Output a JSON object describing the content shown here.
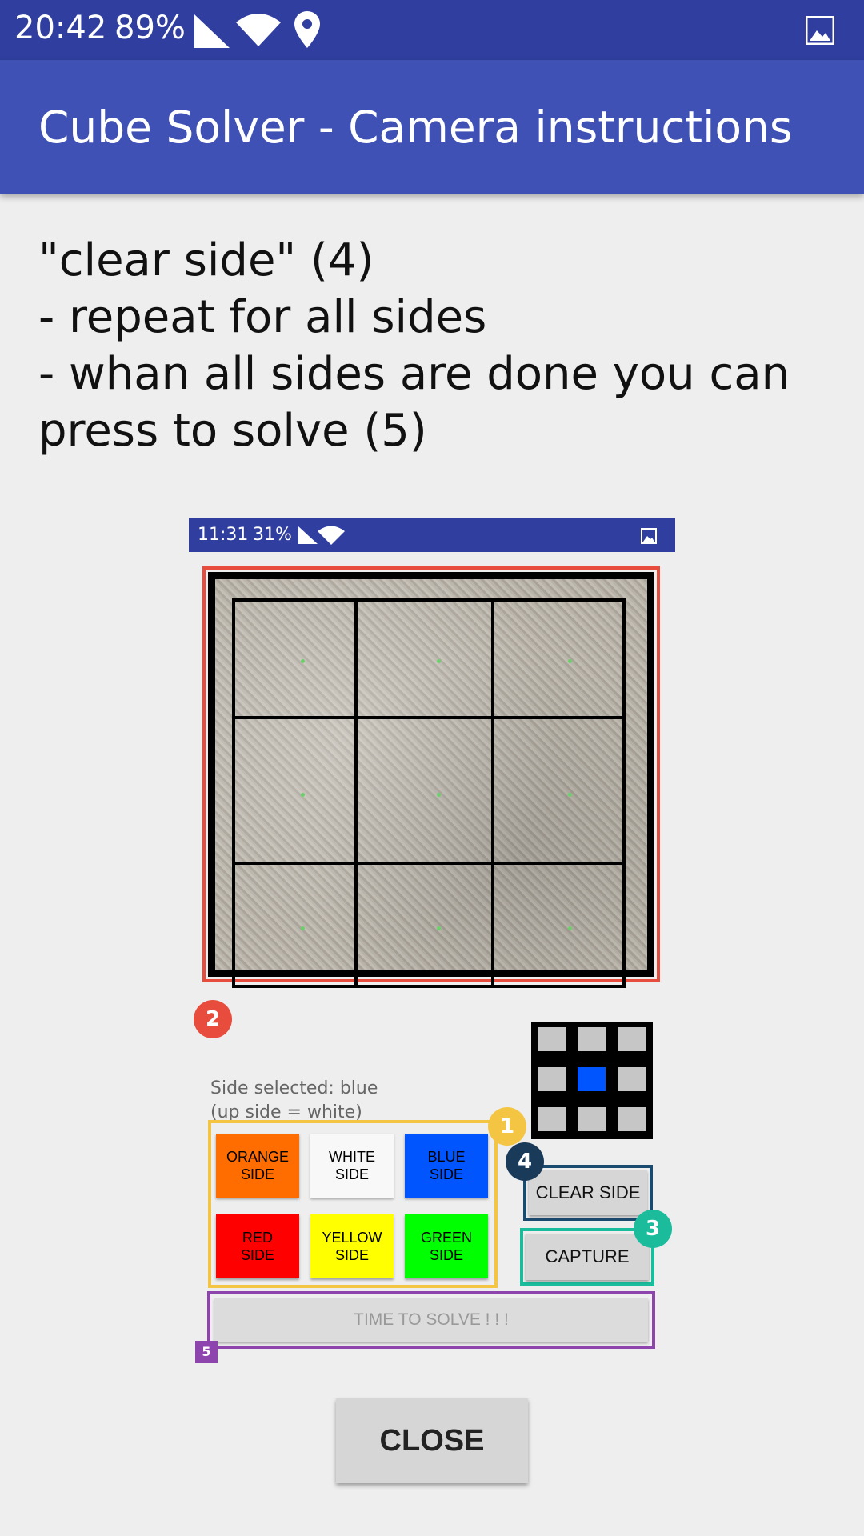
{
  "status_bar": {
    "time": "20:42",
    "battery": "89%",
    "icons": [
      "signal-icon",
      "wifi-icon",
      "location-icon",
      "image-icon"
    ]
  },
  "app_bar": {
    "title": "Cube Solver - Camera instructions"
  },
  "instructions_text": "\"clear side\" (4)\n- repeat for all sides\n- whan all sides are done you can press to solve (5)",
  "mini_screenshot": {
    "status_bar": {
      "time": "11:31",
      "battery": "31%"
    },
    "side_selected_text": "Side selected: blue\n(up side = white)",
    "selected_color": "#0055ff",
    "color_buttons": [
      {
        "label": "ORANGE\nSIDE",
        "color": "#ff6d00"
      },
      {
        "label": "WHITE\nSIDE",
        "color": "#f8f8f8"
      },
      {
        "label": "BLUE\nSIDE",
        "color": "#0055ff"
      },
      {
        "label": "RED\nSIDE",
        "color": "#ff0000"
      },
      {
        "label": "YELLOW\nSIDE",
        "color": "#ffff00"
      },
      {
        "label": "GREEN\nSIDE",
        "color": "#00ff00"
      }
    ],
    "clear_side_label": "CLEAR SIDE",
    "capture_label": "CAPTURE",
    "solve_label": "TIME TO SOLVE ! ! !",
    "badges": [
      "1",
      "2",
      "3",
      "4",
      "5"
    ],
    "badge_colors": {
      "1": "#f4c542",
      "2": "#e74c3c",
      "3": "#1abc9c",
      "4": "#1a3a5a",
      "5": "#8e44ad"
    }
  },
  "close_label": "CLOSE"
}
